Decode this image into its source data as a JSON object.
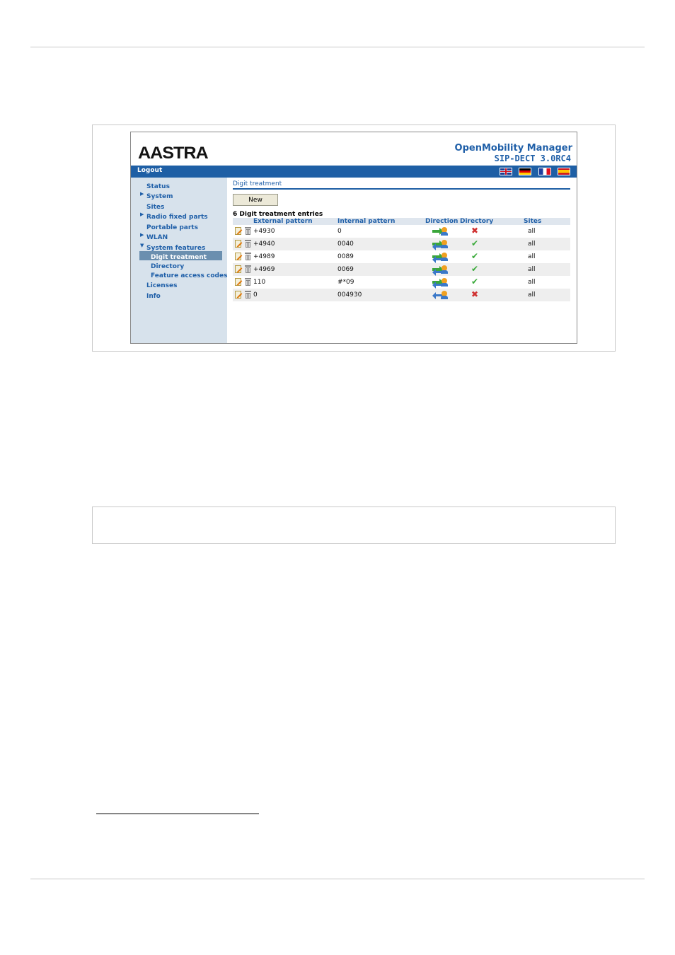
{
  "app": {
    "logo": "AASTRA",
    "title": "OpenMobility Manager",
    "version": "SIP-DECT 3.0RC4"
  },
  "topbar": {
    "logout": "Logout",
    "flags": [
      "uk-flag-icon",
      "de-flag-icon",
      "fr-flag-icon",
      "es-flag-icon"
    ]
  },
  "sidebar": {
    "items": [
      {
        "label": "Status",
        "expandable": false
      },
      {
        "label": "System",
        "expandable": true
      },
      {
        "label": "Sites",
        "expandable": false
      },
      {
        "label": "Radio fixed parts",
        "expandable": true
      },
      {
        "label": "Portable parts",
        "expandable": false
      },
      {
        "label": "WLAN",
        "expandable": true
      },
      {
        "label": "System features",
        "expandable": true,
        "expanded": true
      },
      {
        "label": "Digit treatment",
        "sub": true,
        "active": true
      },
      {
        "label": "Directory",
        "sub": true
      },
      {
        "label": "Feature access codes",
        "sub": true
      },
      {
        "label": "Licenses",
        "expandable": false
      },
      {
        "label": "Info",
        "expandable": false
      }
    ]
  },
  "main": {
    "section_title": "Digit treatment",
    "new_button": "New",
    "count_text": "6 Digit treatment entries",
    "columns": [
      "External pattern",
      "Internal pattern",
      "Direction",
      "Directory",
      "Sites"
    ],
    "rows": [
      {
        "external": "+4930",
        "internal": "0",
        "direction": "incoming",
        "directory": "no",
        "sites": "all"
      },
      {
        "external": "+4940",
        "internal": "0040",
        "direction": "both",
        "directory": "yes",
        "sites": "all"
      },
      {
        "external": "+4989",
        "internal": "0089",
        "direction": "both",
        "directory": "yes",
        "sites": "all"
      },
      {
        "external": "+4969",
        "internal": "0069",
        "direction": "both",
        "directory": "yes",
        "sites": "all"
      },
      {
        "external": "110",
        "internal": "#*09",
        "direction": "both",
        "directory": "yes",
        "sites": "all"
      },
      {
        "external": "0",
        "internal": "004930",
        "direction": "outgoing",
        "directory": "no",
        "sites": "all"
      }
    ]
  },
  "colors": {
    "brand_blue": "#1e5fa5",
    "sidebar_bg": "#d7e2ec",
    "yes_green": "#3aaa3a",
    "no_red": "#d03030"
  }
}
